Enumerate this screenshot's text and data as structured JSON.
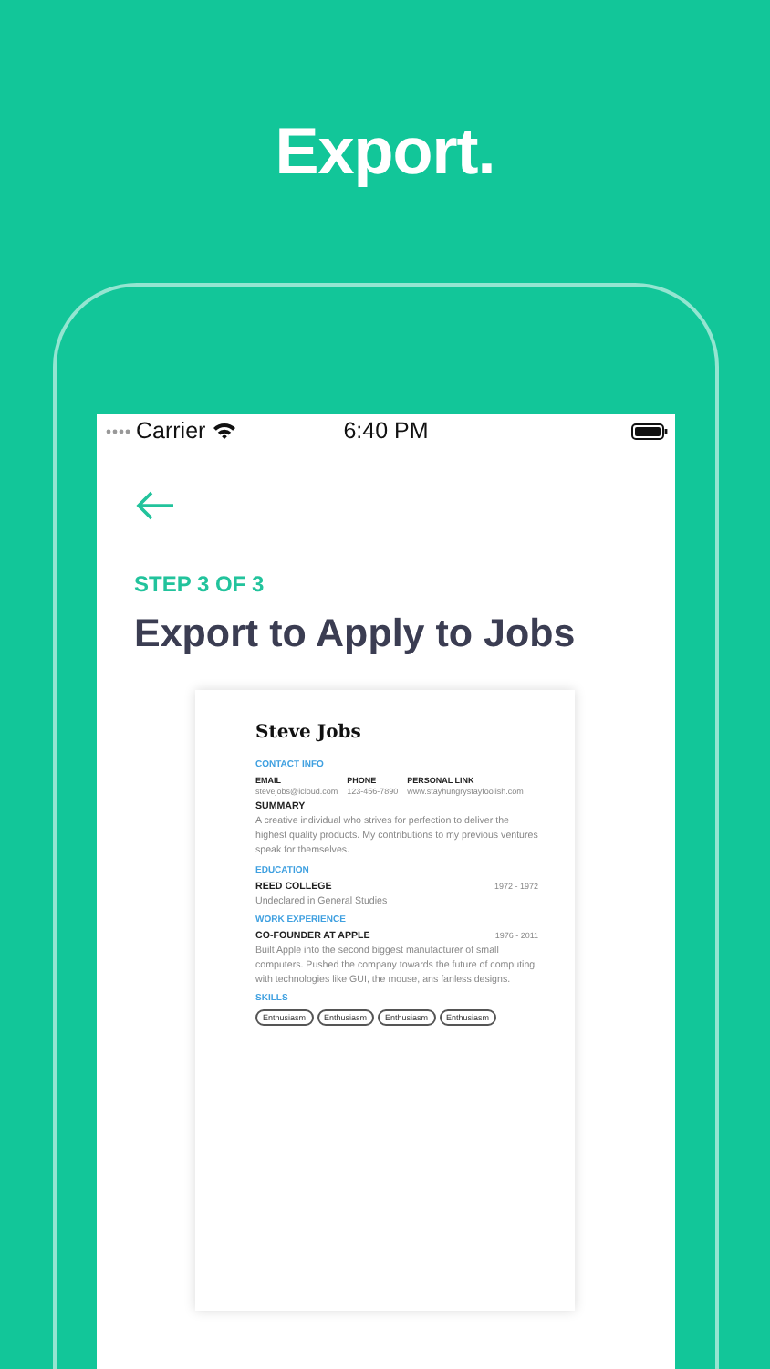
{
  "banner": {
    "title": "Export."
  },
  "status_bar": {
    "carrier": "Carrier",
    "time": "6:40 PM"
  },
  "step": "STEP 3 OF 3",
  "heading": "Export to Apply to Jobs",
  "resume": {
    "name": "Steve Jobs",
    "sections": [
      {
        "kind": "contact",
        "title": "CONTACT INFO",
        "fields": [
          {
            "label": "EMAIL",
            "value": "stevejobs@icloud.com"
          },
          {
            "label": "PHONE",
            "value": "123-456-7890"
          },
          {
            "label": "PERSONAL LINK",
            "value": "www.stayhungrystayfoolish.com"
          }
        ]
      },
      {
        "kind": "summary",
        "title": "SUMMARY",
        "text": "A creative individual who strives for perfection to deliver the highest quality products. My contributions to my previous ventures speak for themselves."
      },
      {
        "kind": "entries",
        "title": "EDUCATION",
        "entries": [
          {
            "heading": "REED COLLEGE",
            "dates": "1972 - 1972",
            "text": "Undeclared in General Studies"
          }
        ]
      },
      {
        "kind": "entries",
        "title": "WORK EXPERIENCE",
        "entries": [
          {
            "heading": "CO-FOUNDER AT APPLE",
            "dates": "1976 - 2011",
            "text": "Built Apple into the second biggest manufacturer of small computers. Pushed the company towards the future of computing with technologies like GUI, the mouse, ans fanless designs."
          }
        ]
      },
      {
        "kind": "skills",
        "title": "SKILLS",
        "skills": [
          "Enthusiasm",
          "Enthusiasm",
          "Enthusiasm",
          "Enthusiasm"
        ]
      }
    ]
  }
}
